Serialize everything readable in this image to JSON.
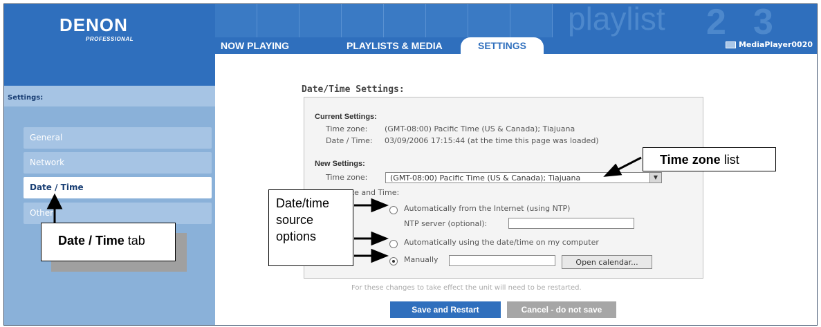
{
  "brand": {
    "name": "DENON",
    "sub": "PROFESSIONAL"
  },
  "nav": {
    "tabs": [
      {
        "label": "NOW PLAYING"
      },
      {
        "label": "PLAYLISTS & MEDIA"
      },
      {
        "label": "SETTINGS"
      }
    ],
    "active_tab": "SETTINGS",
    "device_name": "MediaPlayer0020",
    "banner_word": "playlist"
  },
  "sidebar": {
    "title": "Settings:",
    "items": [
      {
        "label": "General"
      },
      {
        "label": "Network"
      },
      {
        "label": "Date / Time"
      },
      {
        "label": "Other"
      }
    ],
    "active_item": "Date / Time"
  },
  "datetime": {
    "section_title": "Date/Time Settings:",
    "current_heading": "Current Settings:",
    "current_tz_label": "Time zone:",
    "current_tz_value": "(GMT-08:00) Pacific Time (US & Canada); Tiajuana",
    "current_dt_label": "Date / Time:",
    "current_dt_value": "03/09/2006 17:15:44 (at the time this page was loaded)",
    "new_heading": "New Settings:",
    "new_tz_label": "Time zone:",
    "new_tz_selected": "(GMT-08:00) Pacific Time (US & Canada); Tiajuana",
    "set_label": "Set Date and Time:",
    "opt_ntp": "Automatically from the Internet (using NTP)",
    "ntp_server_label": "NTP server (optional):",
    "ntp_server_value": "",
    "opt_computer": "Automatically using the date/time on my computer",
    "opt_manual": "Manually",
    "manual_value": "",
    "open_calendar": "Open calendar...",
    "selected_option": "Manually"
  },
  "footer": {
    "note": "For these changes to take effect the unit will need to be restarted.",
    "save_label": "Save and Restart",
    "cancel_label": "Cancel - do not save"
  },
  "callouts": {
    "tz_bold": "Time zone",
    "tz_rest": " list",
    "src_line1": "Date/time",
    "src_line2": "source",
    "src_line3": "options",
    "tab_bold": "Date / Time",
    "tab_rest": " tab"
  },
  "colors": {
    "accent_blue": "#2f6fbd",
    "sidebar_blue": "#8ab1d9",
    "cancel_gray": "#a6a6a6"
  }
}
